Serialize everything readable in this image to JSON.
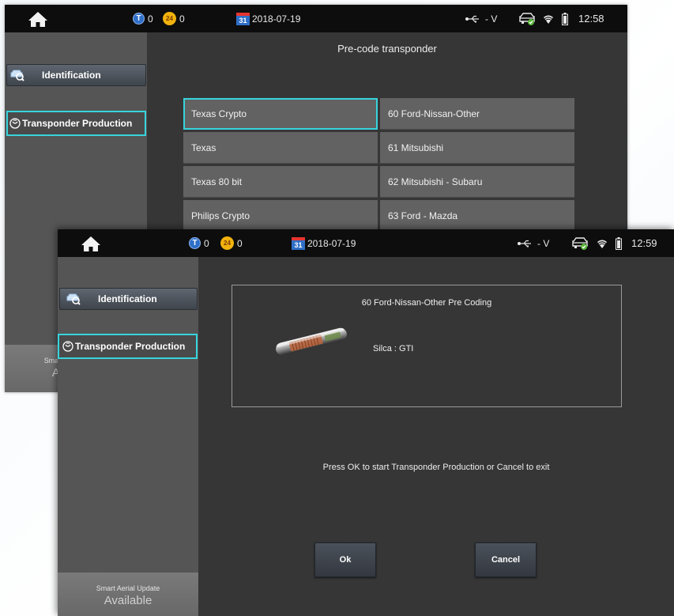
{
  "back_window": {
    "status": {
      "t_count": "0",
      "h_count": "0",
      "calendar_day": "31",
      "date": "2018-07-19",
      "voltage": "- V",
      "time": "12:58"
    },
    "sidebar": {
      "identification_label": "Identification",
      "transponder_label": "Transponder Production",
      "update_small": "Smart Aerial Update",
      "update_big": "Available"
    },
    "title": "Pre-code transponder",
    "grid": [
      [
        "Texas Crypto",
        "60 Ford-Nissan-Other"
      ],
      [
        "Texas",
        "61 Mitsubishi"
      ],
      [
        "Texas 80 bit",
        "62 Mitsubishi - Subaru"
      ],
      [
        "Philips Crypto",
        "63 Ford - Mazda"
      ]
    ]
  },
  "front_window": {
    "status": {
      "t_count": "0",
      "h_count": "0",
      "calendar_day": "31",
      "date": "2018-07-19",
      "voltage": "- V",
      "time": "12:59"
    },
    "sidebar": {
      "identification_label": "Identification",
      "transponder_label": "Transponder Production",
      "update_small": "Smart Aerial Update",
      "update_big": "Available"
    },
    "info_title": "60 Ford-Nissan-Other Pre Coding",
    "info_code": "Silca : GTI",
    "prompt": "Press OK to start Transponder Production or Cancel to exit",
    "ok_label": "Ok",
    "cancel_label": "Cancel"
  },
  "colors": {
    "selection": "#37d4dc",
    "screen_bg": "#363636",
    "status_bg": "#0d0d0d",
    "sidebar_bg": "#555555",
    "cell_bg": "#626262"
  },
  "icons": [
    "home-icon",
    "transponder-counter-icon",
    "hour-counter-icon",
    "calendar-icon",
    "usb-icon",
    "car-connection-icon",
    "wifi-icon",
    "battery-icon",
    "identification-icon",
    "transponder-production-icon",
    "transponder-chip-icon"
  ]
}
